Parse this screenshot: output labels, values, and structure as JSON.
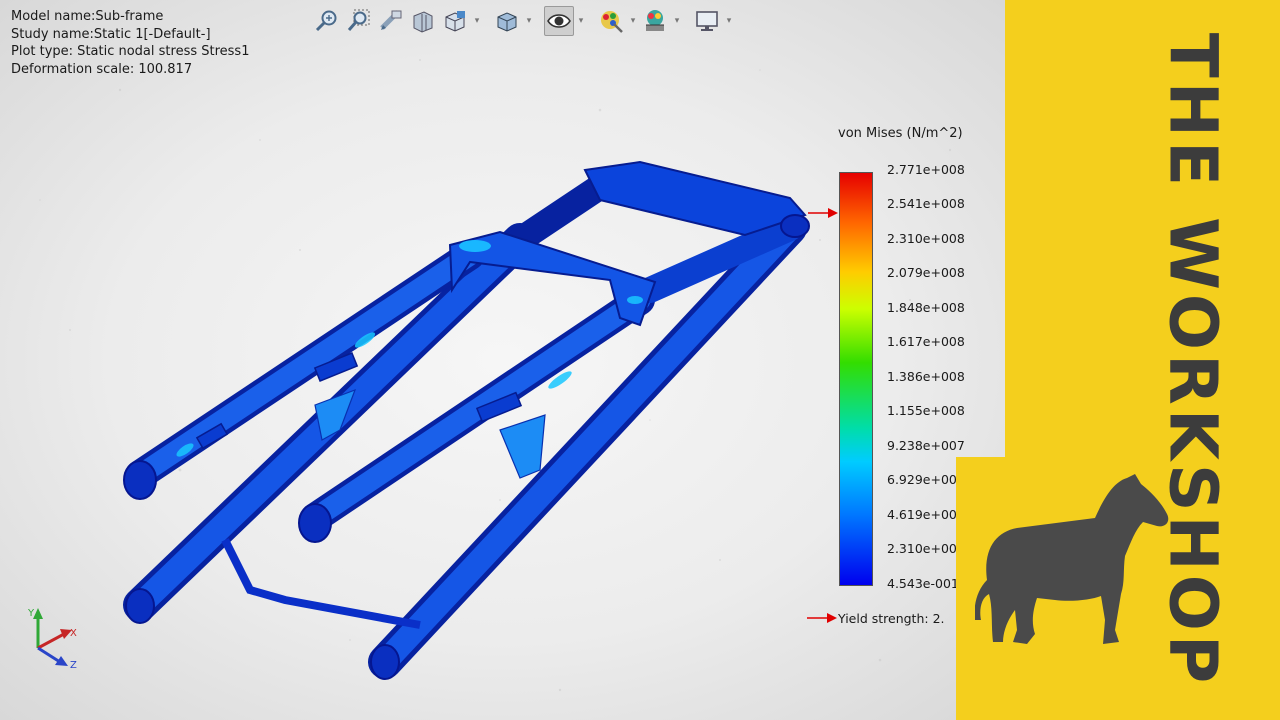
{
  "study_info": {
    "model_name": "Model name:Sub-frame",
    "study_name": "Study name:Static 1[-Default-]",
    "plot_type": "Plot type: Static nodal stress Stress1",
    "deformation_scale": "Deformation scale: 100.817"
  },
  "toolbar": {
    "icons": [
      "zoom-to-fit-icon",
      "zoom-to-area-icon",
      "previous-view-icon",
      "section-view-icon",
      "view-orientation-icon",
      "display-style-icon",
      "hide-show-items-icon",
      "edit-appearance-icon",
      "apply-scene-icon",
      "view-settings-icon"
    ]
  },
  "legend": {
    "title": "von Mises (N/m^2)",
    "ticks": [
      "2.771e+008",
      "2.541e+008",
      "2.310e+008",
      "2.079e+008",
      "1.848e+008",
      "1.617e+008",
      "1.386e+008",
      "1.155e+008",
      "9.238e+007",
      "6.929e+00",
      "4.619e+00",
      "2.310e+00",
      "4.543e-001"
    ],
    "yield_label": "Yield strength: 2.",
    "colors": {
      "max": "#e60000",
      "min": "#0000ee",
      "yield_arrow": "#e00000"
    }
  },
  "triad": {
    "x_label": "X",
    "y_label": "Y",
    "z_label": "Z"
  },
  "brand": {
    "title": "THE WORKSHOP",
    "background": "#f4cf1d",
    "text_color": "#3c3c3c",
    "logo_icon": "horse-silhouette-icon"
  }
}
